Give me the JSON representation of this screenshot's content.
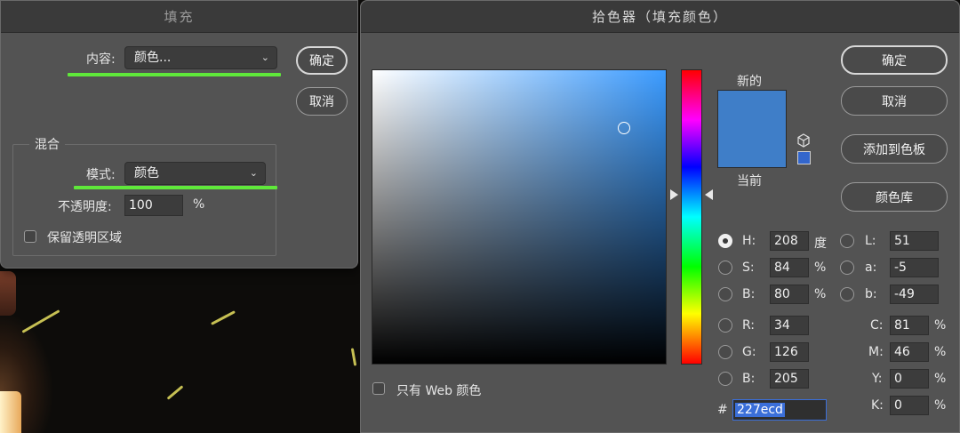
{
  "fill_dialog": {
    "title": "填充",
    "contents_label": "内容:",
    "contents_value": "颜色...",
    "ok_label": "确定",
    "cancel_label": "取消",
    "blending_title": "混合",
    "mode_label": "模式:",
    "mode_value": "颜色",
    "opacity_label": "不透明度:",
    "opacity_value": "100",
    "opacity_unit": "%",
    "preserve_label": "保留透明区域"
  },
  "color_picker": {
    "title": "拾色器（填充颜色）",
    "new_label": "新的",
    "current_label": "当前",
    "buttons": {
      "ok": "确定",
      "cancel": "取消",
      "add_to_swatches": "添加到色板",
      "color_libraries": "颜色库"
    },
    "web_only_label": "只有 Web 颜色",
    "new_color": "#3f7ec8",
    "current_color": "#3f7ec8",
    "websafe_color": "#3366cc",
    "hsb": {
      "h_label": "H:",
      "h": "208",
      "h_unit": "度",
      "s_label": "S:",
      "s": "84",
      "s_unit": "%",
      "b_label": "B:",
      "b": "80",
      "b_unit": "%"
    },
    "lab": {
      "l_label": "L:",
      "l": "51",
      "a_label": "a:",
      "a": "-5",
      "b_label": "b:",
      "b": "-49"
    },
    "rgb": {
      "r_label": "R:",
      "r": "34",
      "g_label": "G:",
      "g": "126",
      "b_label": "B:",
      "b": "205"
    },
    "cmyk": {
      "c_label": "C:",
      "c": "81",
      "m_label": "M:",
      "m": "46",
      "y_label": "Y:",
      "y": "0",
      "k_label": "K:",
      "k": "0",
      "unit": "%"
    },
    "hex_label": "#",
    "hex_value": "227ecd"
  }
}
